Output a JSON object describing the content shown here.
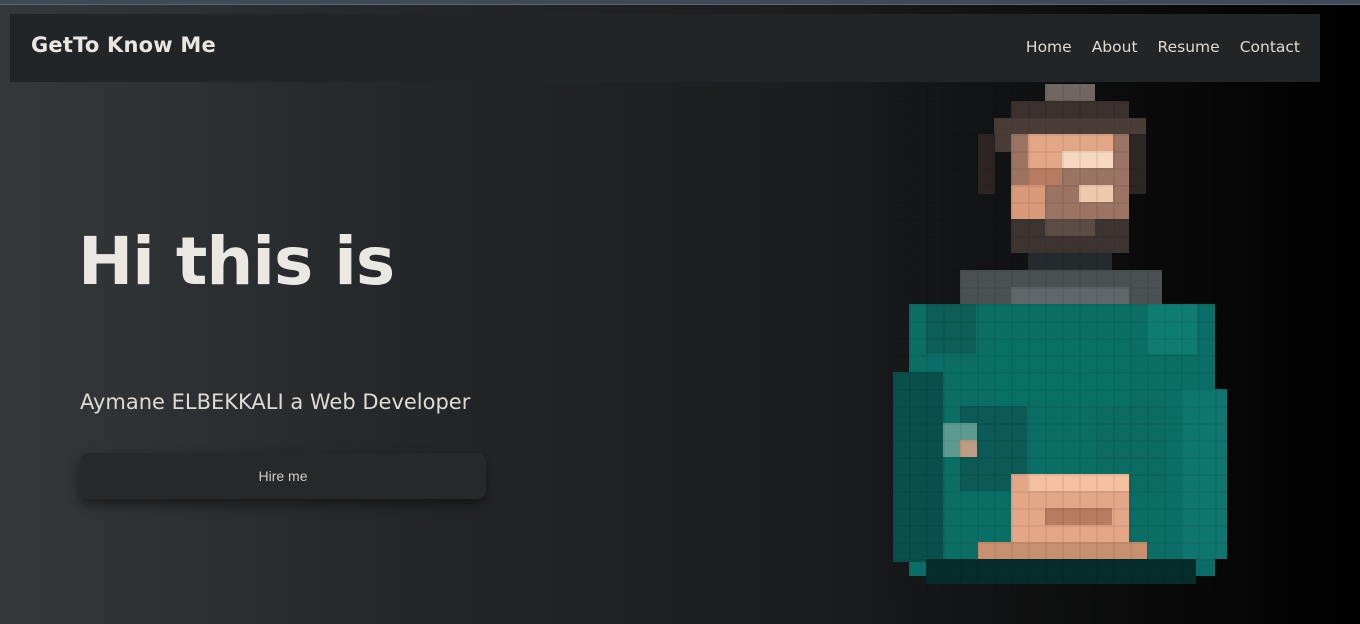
{
  "navbar": {
    "brand": "GetTo Know Me",
    "links": [
      "Home",
      "About",
      "Resume",
      "Contact"
    ]
  },
  "hero": {
    "title": "Hi this is",
    "subtitle": "Aymane ELBEKKALI a Web Developer",
    "cta_label": "Hire me"
  },
  "colors": {
    "navbar_bg": "#222528",
    "text": "#ebe8e3",
    "sweater": "#0b6e66",
    "skin": "#d89a78"
  }
}
